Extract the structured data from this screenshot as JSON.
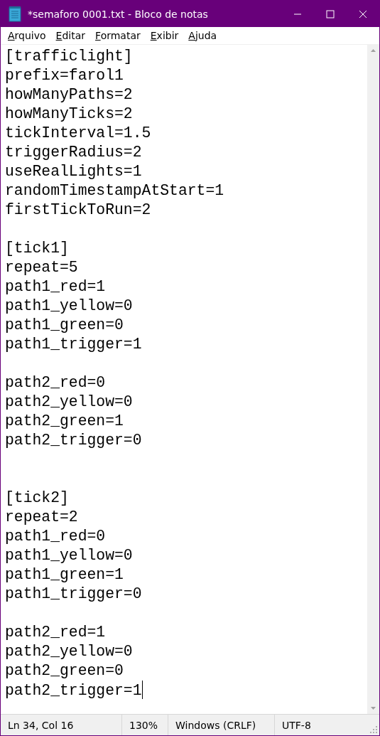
{
  "window": {
    "title": "*semaforo 0001.txt - Bloco de notas"
  },
  "menu": [
    "Arquivo",
    "Editar",
    "Formatar",
    "Exibir",
    "Ajuda"
  ],
  "editor": {
    "text": "[trafficlight]\nprefix=farol1\nhowManyPaths=2\nhowManyTicks=2\ntickInterval=1.5\ntriggerRadius=2\nuseRealLights=1\nrandomTimestampAtStart=1\nfirstTickToRun=2\n\n[tick1]\nrepeat=5\npath1_red=1\npath1_yellow=0\npath1_green=0\npath1_trigger=1\n\npath2_red=0\npath2_yellow=0\npath2_green=1\npath2_trigger=0\n\n\n[tick2]\nrepeat=2\npath1_red=0\npath1_yellow=0\npath1_green=1\npath1_trigger=0\n\npath2_red=1\npath2_yellow=0\npath2_green=0\npath2_trigger=1"
  },
  "status_bar": [
    "Ln 34, Col 16",
    "130%",
    "Windows (CRLF)",
    "UTF-8"
  ]
}
